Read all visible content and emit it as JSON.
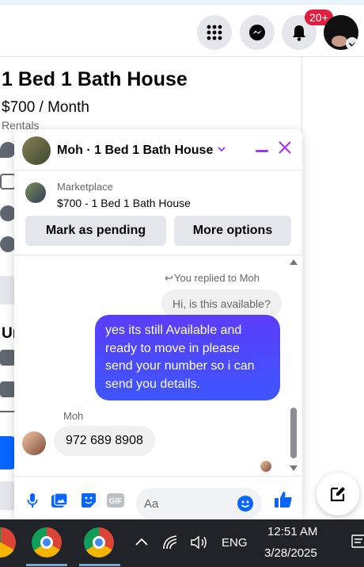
{
  "header": {
    "notification_count": "20+",
    "icons": [
      "menu-grid-icon",
      "messenger-icon",
      "bell-icon",
      "chevron-down-icon"
    ]
  },
  "listing": {
    "title": "1 Bed 1 Bath House",
    "price": "$700 / Month",
    "category": "Rentals",
    "partial_heading": "Ur"
  },
  "chat": {
    "title": "Moh · 1 Bed 1 Bath House",
    "marketplace_label": "Marketplace",
    "item_line": "$700 - 1 Bed 1 Bath House",
    "mark_pending": "Mark as pending",
    "more_options": "More options",
    "replied_label": "You replied to Moh",
    "quoted_message": "Hi, is this available?",
    "outgoing_message": "yes its still Available and ready to move in please send your number so i can send you details.",
    "sender_name": "Moh",
    "incoming_message": "972 689 8908",
    "input_placeholder": "Aa",
    "accent_color": "#a033ff"
  },
  "taskbar": {
    "time": "12:51 AM",
    "date": "3/28/2025",
    "language": "ENG"
  }
}
